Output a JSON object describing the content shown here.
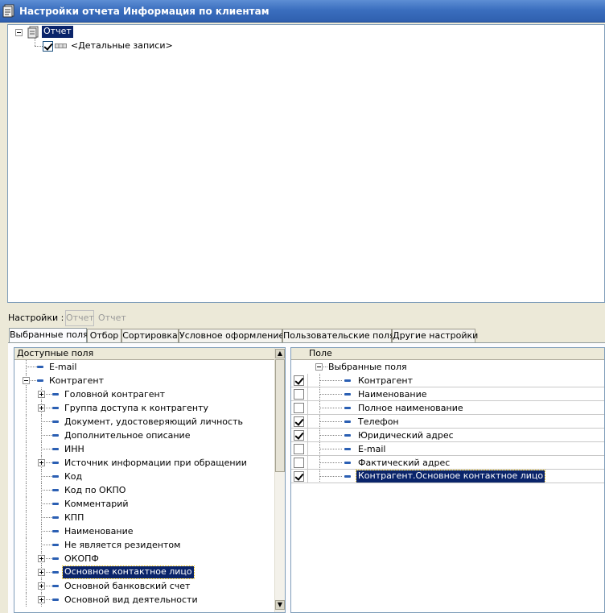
{
  "window": {
    "title": "Настройки отчета  Информация по клиентам",
    "icon": "report-settings-icon"
  },
  "report_tree": {
    "root_label": "Отчет",
    "child_label": "<Детальные записи>",
    "child_checked": true
  },
  "settings": {
    "label": "Настройки :",
    "button_label": "Отчет",
    "value": "Отчет"
  },
  "tabs": [
    {
      "label": "Выбранные поля",
      "active": true
    },
    {
      "label": "Отбор"
    },
    {
      "label": "Сортировка"
    },
    {
      "label": "Условное оформление"
    },
    {
      "label": "Пользовательские поля"
    },
    {
      "label": "Другие настройки"
    }
  ],
  "available_fields": {
    "header": "Доступные поля",
    "items": [
      {
        "label": "E-mail",
        "level": 0
      },
      {
        "label": "Контрагент",
        "level": 0,
        "expandable": true,
        "expanded": true
      },
      {
        "label": "Головной контрагент",
        "level": 1,
        "expandable": true
      },
      {
        "label": "Группа доступа к контрагенту",
        "level": 1,
        "expandable": true
      },
      {
        "label": "Документ, удостоверяющий личность",
        "level": 1
      },
      {
        "label": "Дополнительное описание",
        "level": 1
      },
      {
        "label": "ИНН",
        "level": 1
      },
      {
        "label": "Источник информации при обращении",
        "level": 1,
        "expandable": true
      },
      {
        "label": "Код",
        "level": 1
      },
      {
        "label": "Код по ОКПО",
        "level": 1
      },
      {
        "label": "Комментарий",
        "level": 1
      },
      {
        "label": "КПП",
        "level": 1
      },
      {
        "label": "Наименование",
        "level": 1
      },
      {
        "label": "Не является резидентом",
        "level": 1
      },
      {
        "label": "ОКОПФ",
        "level": 1,
        "expandable": true
      },
      {
        "label": "Основное контактное лицо",
        "level": 1,
        "expandable": true,
        "selected": true
      },
      {
        "label": "Основной банковский счет",
        "level": 1,
        "expandable": true
      },
      {
        "label": "Основной вид деятельности",
        "level": 1,
        "expandable": true
      }
    ]
  },
  "selected_fields": {
    "header": "Поле",
    "root_label": "Выбранные поля",
    "items": [
      {
        "label": "Контрагент",
        "checked": true
      },
      {
        "label": "Наименование",
        "checked": false
      },
      {
        "label": "Полное наименование",
        "checked": false
      },
      {
        "label": "Телефон",
        "checked": true
      },
      {
        "label": "Юридический адрес",
        "checked": true
      },
      {
        "label": "E-mail",
        "checked": false
      },
      {
        "label": "Фактический адрес",
        "checked": false
      },
      {
        "label": "Контрагент.Основное контактное лицо",
        "checked": true,
        "selected": true
      }
    ]
  },
  "colors": {
    "title_bar": "#3b6fbf",
    "selection": "#0a246a",
    "field_icon": "#2b5fb3"
  }
}
